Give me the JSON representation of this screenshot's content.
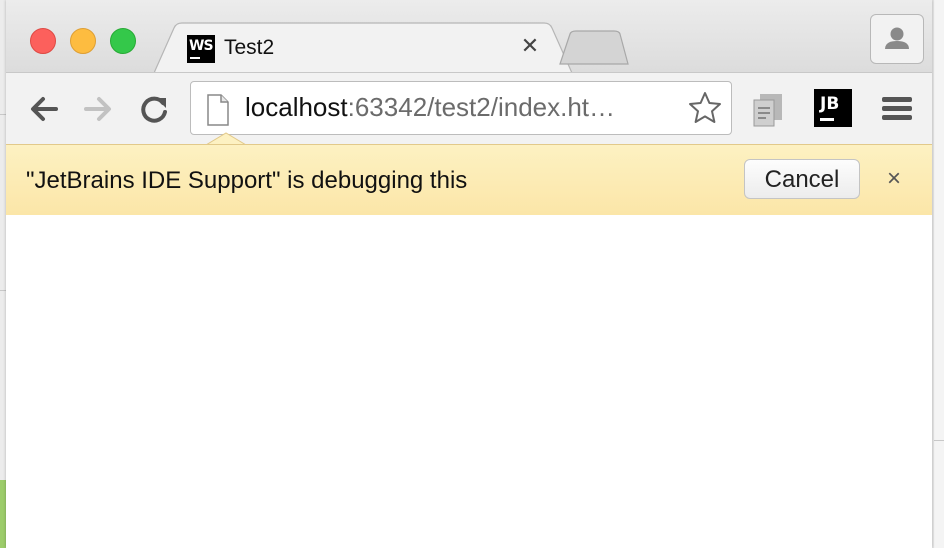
{
  "tab": {
    "title": "Test2",
    "favicon_text": "WS",
    "close_glyph": "✕"
  },
  "omnibox": {
    "host": "localhost",
    "path": ":63342/test2/index.ht…"
  },
  "extensions": {
    "jb_label": "JB"
  },
  "infobar": {
    "message": "\"JetBrains IDE Support\" is debugging this",
    "cancel_label": "Cancel",
    "close_glyph": "×"
  },
  "colors": {
    "infobar_bg": "#fbe6a8",
    "traffic_red": "#fc605c",
    "traffic_yellow": "#fdbc40",
    "traffic_green": "#34c84a"
  },
  "icons": [
    "back-arrow-icon",
    "forward-arrow-icon",
    "reload-icon",
    "page-icon",
    "star-icon",
    "extension-icon",
    "jb-icon",
    "menu-icon",
    "profile-icon"
  ]
}
